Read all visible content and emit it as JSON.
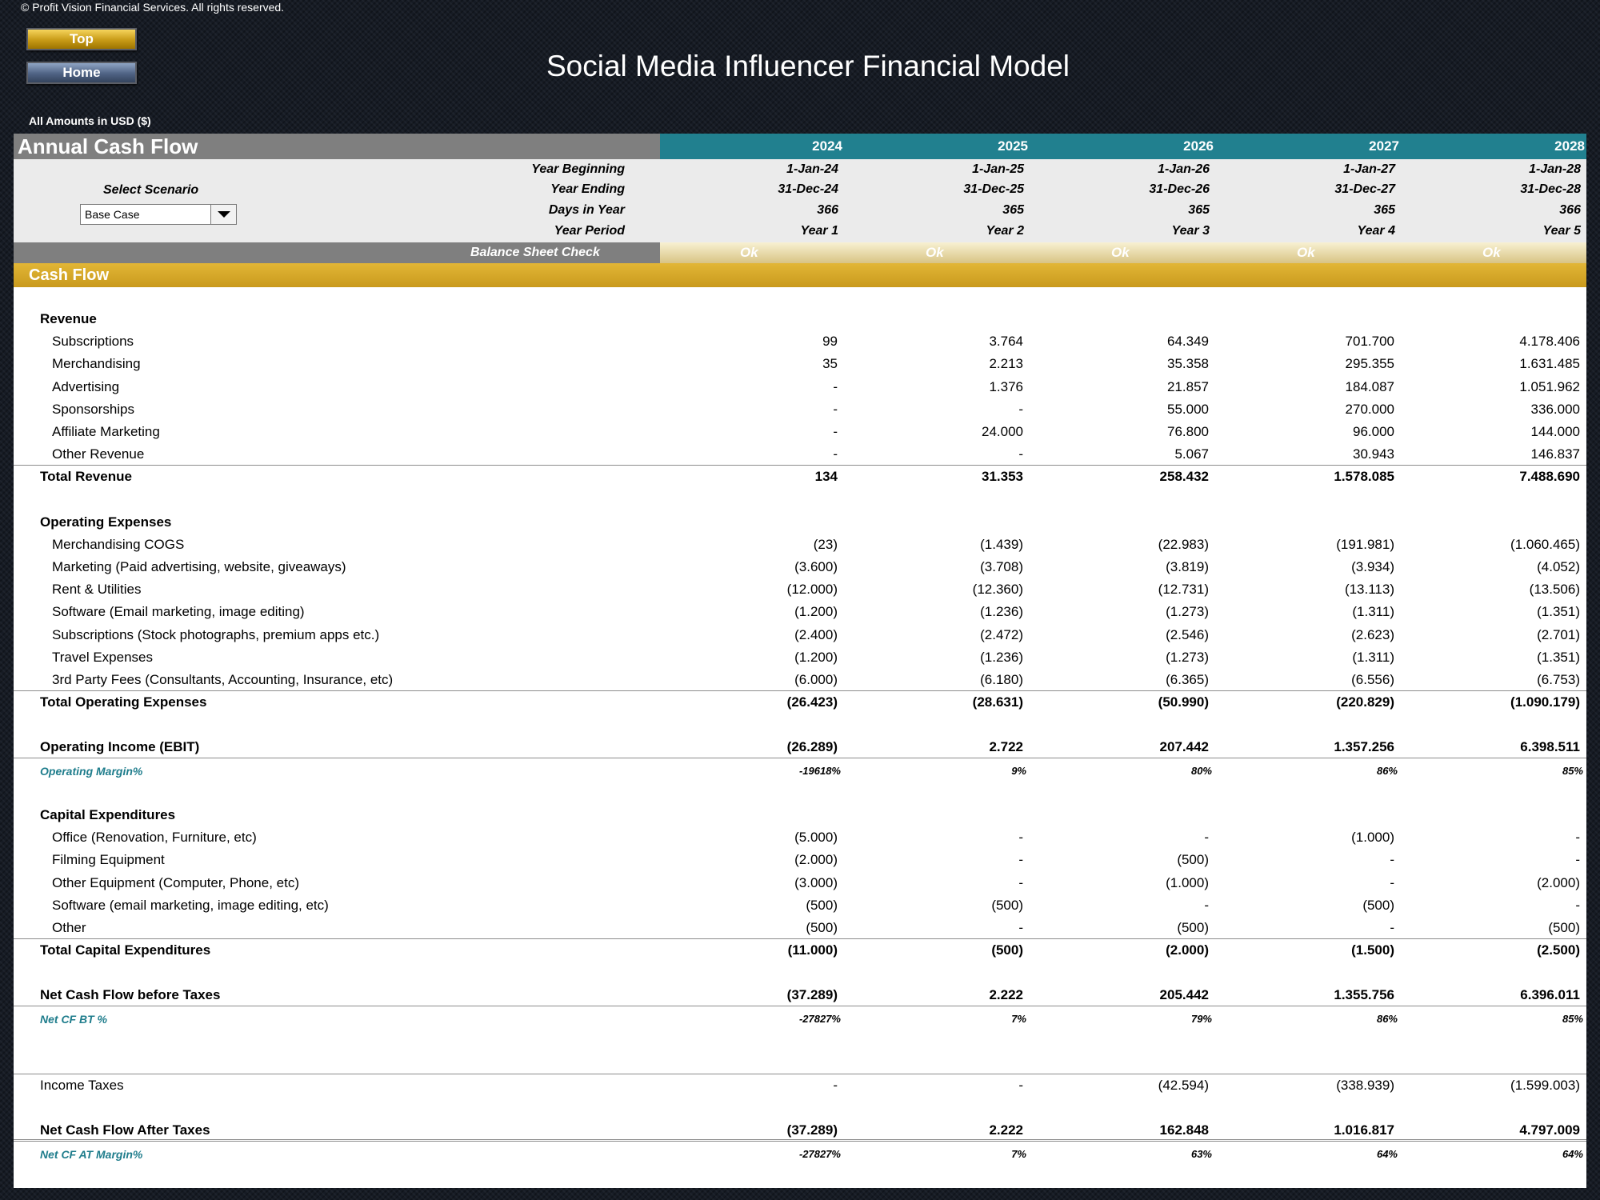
{
  "copyright": "© Profit Vision Financial Services. All rights reserved.",
  "nav": {
    "top_label": "Top",
    "home_label": "Home"
  },
  "title": "Social Media Influencer Financial Model",
  "currency_note": "All Amounts in  USD ($)",
  "sheet": {
    "heading": "Annual Cash Flow",
    "years": [
      "2024",
      "2025",
      "2026",
      "2027",
      "2028"
    ],
    "meta": [
      {
        "label": "Year Beginning",
        "values": [
          "1-Jan-24",
          "1-Jan-25",
          "1-Jan-26",
          "1-Jan-27",
          "1-Jan-28"
        ]
      },
      {
        "label": "Year Ending",
        "values": [
          "31-Dec-24",
          "31-Dec-25",
          "31-Dec-26",
          "31-Dec-27",
          "31-Dec-28"
        ]
      },
      {
        "label": "Days in Year",
        "values": [
          "366",
          "365",
          "365",
          "365",
          "366"
        ]
      },
      {
        "label": "Year Period",
        "values": [
          "Year 1",
          "Year 2",
          "Year 3",
          "Year 4",
          "Year 5"
        ]
      }
    ],
    "scenario": {
      "label": "Select Scenario",
      "selected": "Base Case"
    },
    "balance_check": {
      "label": "Balance Sheet Check",
      "values": [
        "Ok",
        "Ok",
        "Ok",
        "Ok",
        "Ok"
      ]
    },
    "section_title": "Cash Flow",
    "rows": [
      {
        "label": "Revenue",
        "style": "head",
        "values": []
      },
      {
        "label": "Subscriptions",
        "style": "item",
        "values": [
          "99",
          "3.764",
          "64.349",
          "701.700",
          "4.178.406"
        ]
      },
      {
        "label": "Merchandising",
        "style": "item",
        "values": [
          "35",
          "2.213",
          "35.358",
          "295.355",
          "1.631.485"
        ]
      },
      {
        "label": "Advertising",
        "style": "item",
        "values": [
          "-",
          "1.376",
          "21.857",
          "184.087",
          "1.051.962"
        ]
      },
      {
        "label": "Sponsorships",
        "style": "item",
        "values": [
          "-",
          "-",
          "55.000",
          "270.000",
          "336.000"
        ]
      },
      {
        "label": "Affiliate Marketing",
        "style": "item",
        "values": [
          "-",
          "24.000",
          "76.800",
          "96.000",
          "144.000"
        ]
      },
      {
        "label": "Other Revenue",
        "style": "item",
        "values": [
          "-",
          "-",
          "5.067",
          "30.943",
          "146.837"
        ]
      },
      {
        "label": "Total Revenue",
        "style": "total",
        "values": [
          "134",
          "31.353",
          "258.432",
          "1.578.085",
          "7.488.690"
        ]
      },
      {
        "label": "Operating Expenses",
        "style": "head",
        "values": []
      },
      {
        "label": "Merchandising COGS",
        "style": "item",
        "values": [
          "(23)",
          "(1.439)",
          "(22.983)",
          "(191.981)",
          "(1.060.465)"
        ]
      },
      {
        "label": "Marketing (Paid advertising, website, giveaways)",
        "style": "item",
        "values": [
          "(3.600)",
          "(3.708)",
          "(3.819)",
          "(3.934)",
          "(4.052)"
        ]
      },
      {
        "label": "Rent & Utilities",
        "style": "item",
        "values": [
          "(12.000)",
          "(12.360)",
          "(12.731)",
          "(13.113)",
          "(13.506)"
        ]
      },
      {
        "label": "Software (Email marketing, image editing)",
        "style": "item",
        "values": [
          "(1.200)",
          "(1.236)",
          "(1.273)",
          "(1.311)",
          "(1.351)"
        ]
      },
      {
        "label": "Subscriptions (Stock photographs, premium apps etc.)",
        "style": "item",
        "values": [
          "(2.400)",
          "(2.472)",
          "(2.546)",
          "(2.623)",
          "(2.701)"
        ]
      },
      {
        "label": "Travel Expenses",
        "style": "item",
        "values": [
          "(1.200)",
          "(1.236)",
          "(1.273)",
          "(1.311)",
          "(1.351)"
        ]
      },
      {
        "label": "3rd Party Fees (Consultants, Accounting, Insurance, etc)",
        "style": "item",
        "values": [
          "(6.000)",
          "(6.180)",
          "(6.365)",
          "(6.556)",
          "(6.753)"
        ]
      },
      {
        "label": "Total Operating Expenses",
        "style": "total",
        "values": [
          "(26.423)",
          "(28.631)",
          "(50.990)",
          "(220.829)",
          "(1.090.179)"
        ]
      },
      {
        "label": "Operating Income (EBIT)",
        "style": "total",
        "values": [
          "(26.289)",
          "2.722",
          "207.442",
          "1.357.256",
          "6.398.511"
        ]
      },
      {
        "label": "Operating Margin%",
        "style": "pct",
        "values": [
          "-19618%",
          "9%",
          "80%",
          "86%",
          "85%"
        ]
      },
      {
        "label": "Capital Expenditures",
        "style": "head",
        "values": []
      },
      {
        "label": "Office (Renovation, Furniture, etc)",
        "style": "item",
        "values": [
          "(5.000)",
          "-",
          "-",
          "(1.000)",
          "-"
        ]
      },
      {
        "label": "Filming Equipment",
        "style": "item",
        "values": [
          "(2.000)",
          "-",
          "(500)",
          "-",
          "-"
        ]
      },
      {
        "label": "Other Equipment (Computer, Phone, etc)",
        "style": "item",
        "values": [
          "(3.000)",
          "-",
          "(1.000)",
          "-",
          "(2.000)"
        ]
      },
      {
        "label": "Software (email marketing, image editing, etc)",
        "style": "item",
        "values": [
          "(500)",
          "(500)",
          "-",
          "(500)",
          "-"
        ]
      },
      {
        "label": "Other",
        "style": "item",
        "values": [
          "(500)",
          "-",
          "(500)",
          "-",
          "(500)"
        ]
      },
      {
        "label": "Total Capital Expenditures",
        "style": "total",
        "values": [
          "(11.000)",
          "(500)",
          "(2.000)",
          "(1.500)",
          "(2.500)"
        ]
      },
      {
        "label": "Net Cash Flow before Taxes",
        "style": "total",
        "values": [
          "(37.289)",
          "2.222",
          "205.442",
          "1.355.756",
          "6.396.011"
        ]
      },
      {
        "label": "Net CF BT %",
        "style": "pct",
        "values": [
          "-27827%",
          "7%",
          "79%",
          "86%",
          "85%"
        ]
      },
      {
        "label": "Income Taxes",
        "style": "plain",
        "values": [
          "-",
          "-",
          "(42.594)",
          "(338.939)",
          "(1.599.003)"
        ]
      },
      {
        "label": "Net Cash Flow After Taxes",
        "style": "total",
        "values": [
          "(37.289)",
          "2.222",
          "162.848",
          "1.016.817",
          "4.797.009"
        ]
      },
      {
        "label": "Net CF AT Margin%",
        "style": "pct",
        "values": [
          "-27827%",
          "7%",
          "63%",
          "64%",
          "64%"
        ]
      }
    ]
  }
}
